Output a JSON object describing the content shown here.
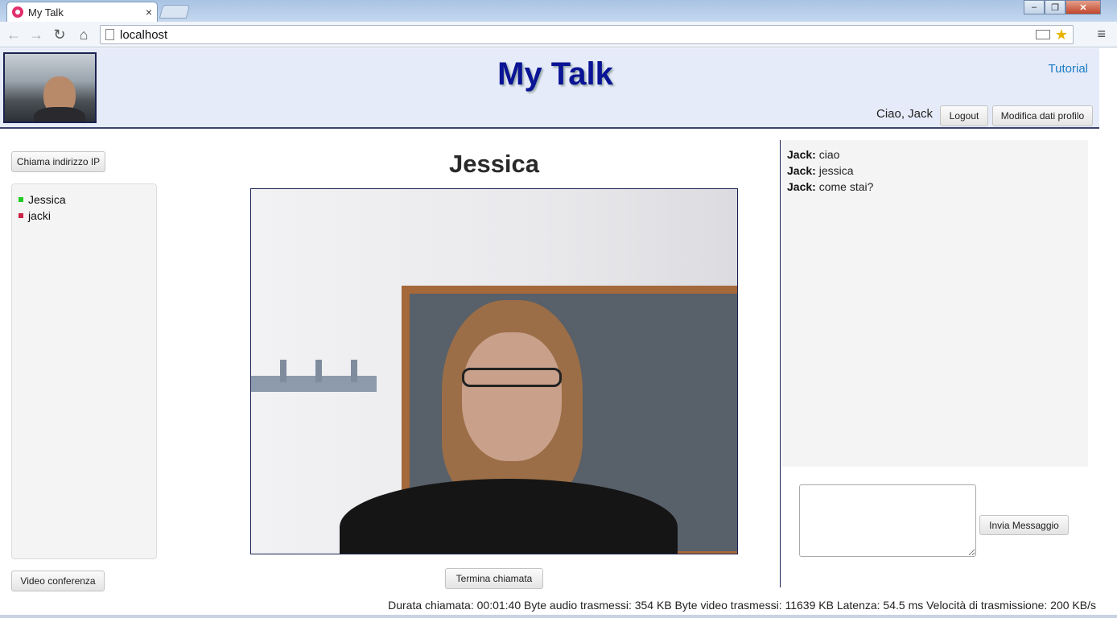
{
  "browser": {
    "tab_title": "My Talk",
    "tab_close": "×",
    "url": "localhost",
    "window_controls": {
      "minimize": "–",
      "restore": "❐",
      "close": "✕"
    }
  },
  "header": {
    "title": "My Talk",
    "tutorial_link": "Tutorial",
    "greeting": "Ciao, Jack",
    "logout_label": "Logout",
    "edit_profile_label": "Modifica dati profilo"
  },
  "sidebar": {
    "call_ip_label": "Chiama indirizzo IP",
    "contacts": [
      {
        "name": "Jessica",
        "status": "online",
        "color": "#22cc22"
      },
      {
        "name": "jacki",
        "status": "offline",
        "color": "#cc2244"
      }
    ],
    "video_conference_label": "Video conferenza"
  },
  "call": {
    "callee_name": "Jessica",
    "end_call_label": "Termina chiamata"
  },
  "chat": {
    "messages": [
      {
        "sender": "Jack:",
        "text": "ciao"
      },
      {
        "sender": "Jack:",
        "text": "jessica"
      },
      {
        "sender": "Jack:",
        "text": "come stai?"
      }
    ],
    "input_value": "",
    "send_label": "Invia Messaggio"
  },
  "status_line": "Durata chiamata: 00:01:40 Byte audio trasmessi: 354 KB Byte video trasmessi: 11639 KB Latenza: 54.5 ms Velocità di trasmissione: 200 KB/s",
  "colors": {
    "title": "#0a1494",
    "header_bg": "#e6ebf9",
    "link": "#1b7cc4"
  }
}
